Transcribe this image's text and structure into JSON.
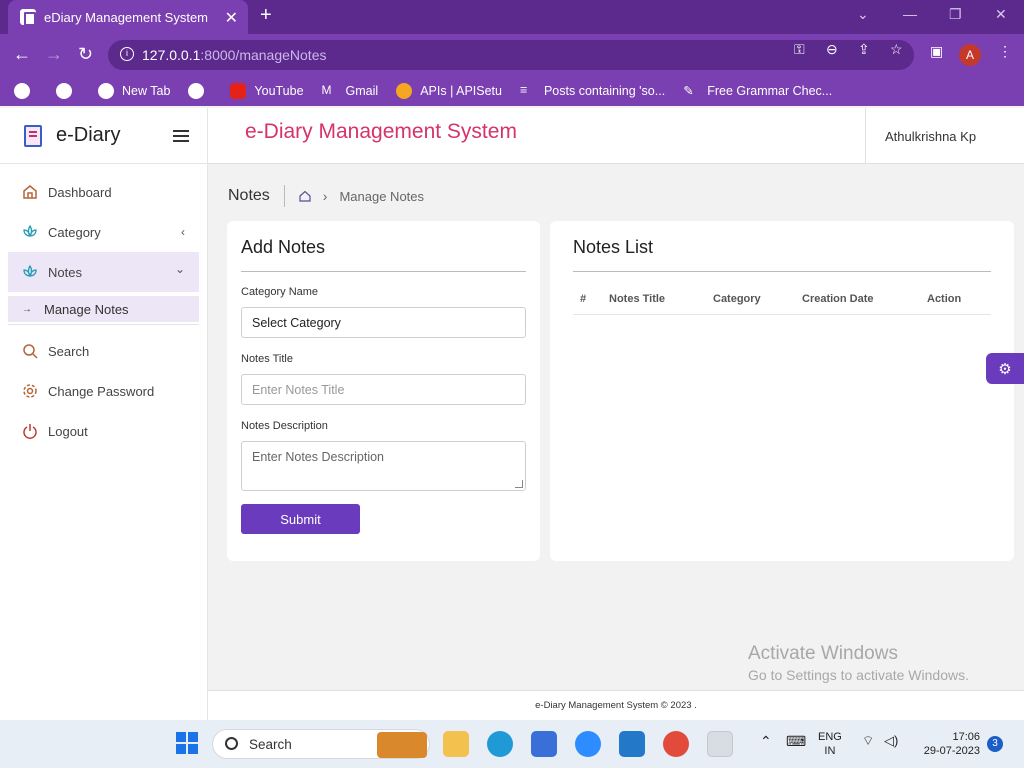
{
  "browser": {
    "tab_title": "eDiary Management System",
    "tab_close": "✕",
    "new_tab": "+",
    "url_host": "127.0.0.1",
    "url_path": ":8000/manageNotes",
    "profile_initial": "A",
    "bookmarks": [
      {
        "label": "",
        "icon": "globe-icon"
      },
      {
        "label": "",
        "icon": "globe-icon"
      },
      {
        "label": "New Tab",
        "icon": "globe-icon"
      },
      {
        "label": "",
        "icon": "globe-icon"
      },
      {
        "label": "YouTube",
        "icon": "youtube-icon"
      },
      {
        "label": "Gmail",
        "icon": "gmail-icon"
      },
      {
        "label": "APIs | APISetu",
        "icon": "apisetu-icon"
      },
      {
        "label": "Posts containing 'so...",
        "icon": "stackoverflow-icon"
      },
      {
        "label": "Free Grammar Chec...",
        "icon": "pen-icon"
      }
    ]
  },
  "sidebar": {
    "brand": "e-Diary",
    "items": [
      {
        "label": "Dashboard",
        "icon": "home-icon"
      },
      {
        "label": "Category",
        "icon": "lotus-icon",
        "chevron": "‹"
      },
      {
        "label": "Notes",
        "icon": "lotus-icon",
        "chevron": "⌄"
      },
      {
        "label": "Search",
        "icon": "search-icon"
      },
      {
        "label": "Change Password",
        "icon": "gear-icon"
      },
      {
        "label": "Logout",
        "icon": "power-icon"
      }
    ],
    "sub_item": "Manage Notes"
  },
  "header": {
    "app_title": "e-Diary Management System",
    "user": "Athulkrishna Kp"
  },
  "breadcrumb": {
    "section": "Notes",
    "page": "Manage Notes"
  },
  "form": {
    "title": "Add Notes",
    "category_label": "Category Name",
    "category_value": "Select Category",
    "title_label": "Notes Title",
    "title_placeholder": "Enter Notes Title",
    "desc_label": "Notes Description",
    "desc_placeholder": "Enter Notes Description",
    "submit": "Submit"
  },
  "list": {
    "title": "Notes List",
    "columns": [
      "#",
      "Notes Title",
      "Category",
      "Creation Date",
      "Action"
    ]
  },
  "watermark": {
    "line1": "Activate Windows",
    "line2": "Go to Settings to activate Windows."
  },
  "footer": "e-Diary Management System © 2023 .",
  "taskbar": {
    "search": "Search",
    "lang1": "ENG",
    "lang2": "IN",
    "time": "17:06",
    "date": "29-07-2023",
    "notifications": "3"
  }
}
